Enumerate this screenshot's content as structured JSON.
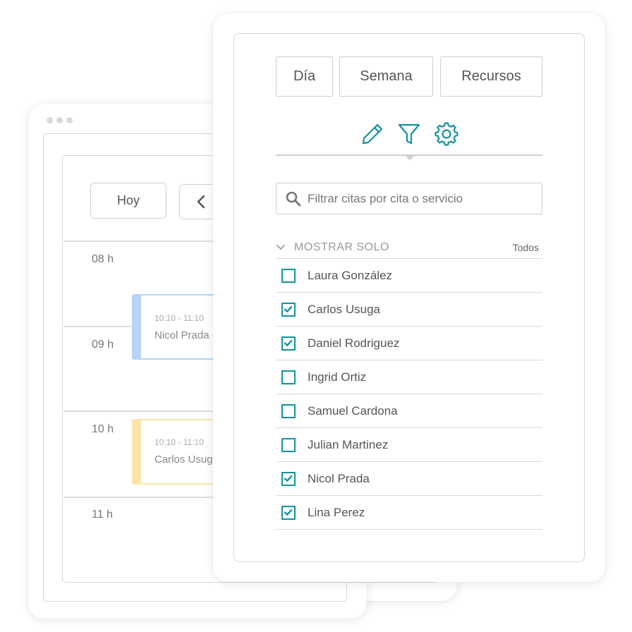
{
  "calendar": {
    "today_label": "Hoy",
    "hours": [
      "08 h",
      "09 h",
      "10 h",
      "11 h"
    ],
    "events": [
      {
        "time": "10:10 - 11:10",
        "title": "Nicol Prada - D",
        "color": "#b7d4f7"
      },
      {
        "time": "10:10 - 11:10",
        "title": "Carlos Usuga -",
        "color": "#fbe4a9"
      }
    ]
  },
  "panel": {
    "views": [
      "Día",
      "Semana",
      "Recursos"
    ],
    "tools": [
      "pencil-icon",
      "filter-icon",
      "gear-icon"
    ],
    "search_placeholder": "Filtrar citas por cita o servicio",
    "section_title": "MOSTRAR SOLO",
    "section_all": "Todos",
    "accent": "#1591a0",
    "people": [
      {
        "name": "Laura González",
        "checked": false
      },
      {
        "name": "Carlos Usuga",
        "checked": true
      },
      {
        "name": "Daniel Rodriguez",
        "checked": true
      },
      {
        "name": "Ingrid Ortiz",
        "checked": false
      },
      {
        "name": "Samuel Cardona",
        "checked": false
      },
      {
        "name": "Julian Martinez",
        "checked": false
      },
      {
        "name": "Nicol Prada",
        "checked": true
      },
      {
        "name": "Lina Perez",
        "checked": true
      }
    ]
  }
}
